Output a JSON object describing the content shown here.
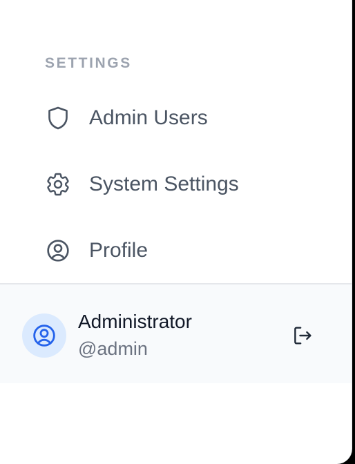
{
  "sidebar": {
    "section_title": "SETTINGS",
    "items": [
      {
        "label": "Admin Users",
        "icon": "shield-icon"
      },
      {
        "label": "System Settings",
        "icon": "gear-icon"
      },
      {
        "label": "Profile",
        "icon": "user-circle-icon"
      }
    ]
  },
  "user": {
    "name": "Administrator",
    "handle": "@admin",
    "avatar_icon": "user-circle-icon",
    "logout_icon": "logout-icon"
  },
  "colors": {
    "text_primary": "#111827",
    "text_nav": "#4b5563",
    "text_muted": "#9ca3af",
    "accent": "#2563eb",
    "avatar_bg": "#dbeafe",
    "panel_bg": "#f8fafc"
  }
}
